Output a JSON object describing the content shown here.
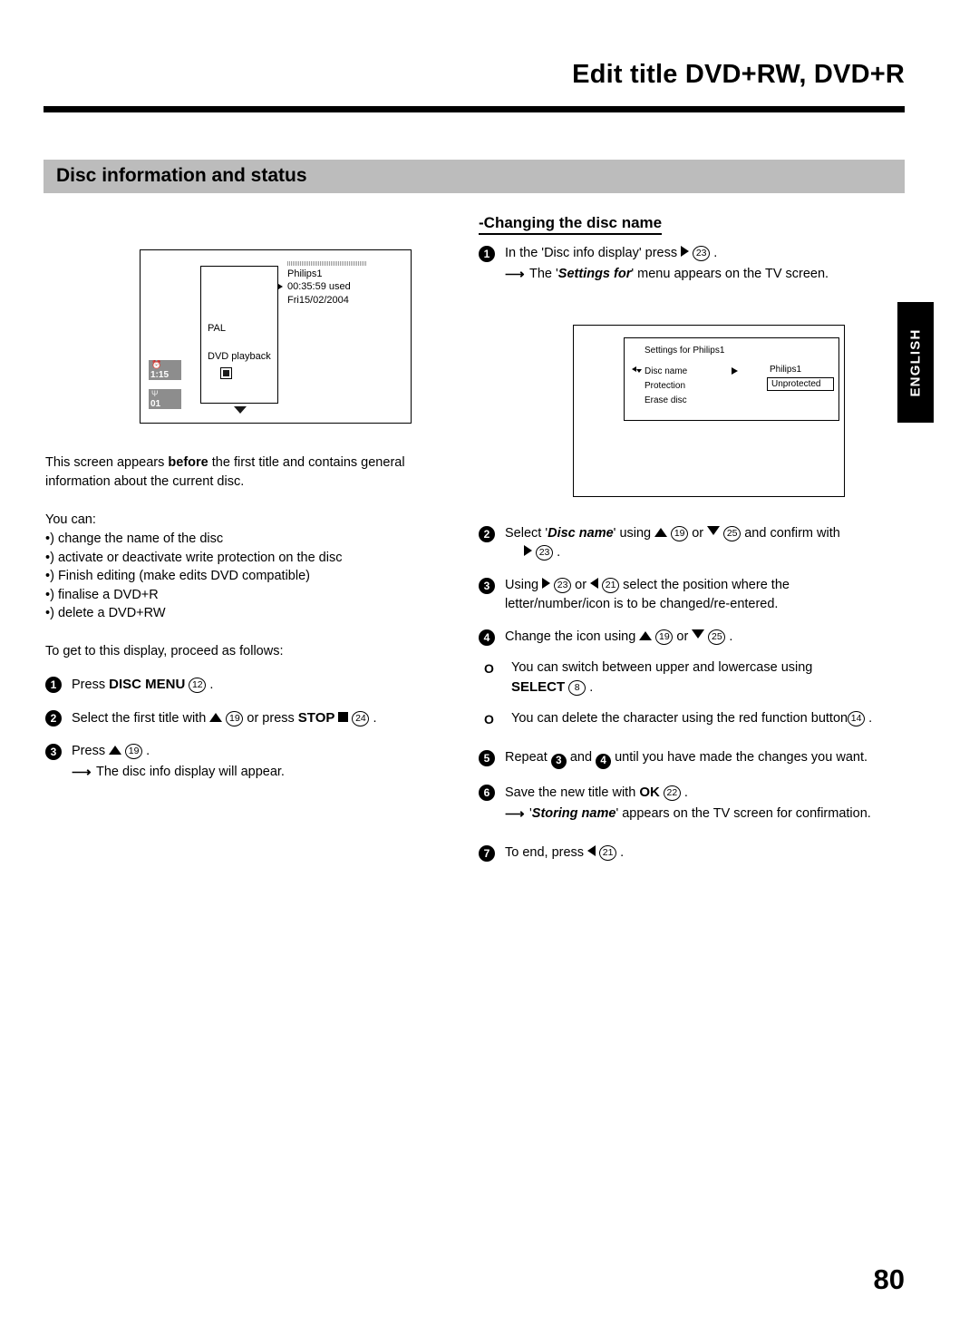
{
  "header": {
    "title": "Edit title DVD+RW, DVD+R"
  },
  "section": {
    "title": "Disc information and status"
  },
  "side_tab": {
    "language": "ENGLISH"
  },
  "disc_info_screen": {
    "disc_name": "Philips1",
    "time_used": "00:35:59 used",
    "date": "Fri15/02/2004",
    "video_standard": "PAL",
    "playback_label": "DVD playback",
    "timer_badge": "1:15",
    "channel_badge": "01"
  },
  "settings_screen": {
    "title": "Settings for Philips1",
    "items": [
      "Disc name",
      "Protection",
      "Erase disc"
    ],
    "value_disc_name": "Philips1",
    "value_protection": "Unprotected"
  },
  "left_column": {
    "intro_1": "This screen appears ",
    "intro_bold": "before",
    "intro_2": " the first title and contains general",
    "intro_line2": "information about the current disc.",
    "you_can_label": "You can:",
    "capabilities": [
      "change the name of the disc",
      "activate or deactivate write protection on the disc",
      "Finish editing (make edits DVD compatible)",
      "finalise a DVD+R",
      "delete a DVD+RW"
    ],
    "howto_label": "To get to this display, proceed as follows:",
    "steps": [
      {
        "num": "1",
        "pre": "Press",
        "key": "DISC MENU",
        "ref": "12",
        "post": "."
      },
      {
        "num": "2",
        "pre": "Select the first title with",
        "ref_up": "19",
        "mid": "or press",
        "key": "STOP",
        "ref_stop": "24",
        "post": "."
      },
      {
        "num": "3",
        "pre": "Press",
        "ref_up": "19",
        "post": ".",
        "result": "The disc info display will appear."
      }
    ]
  },
  "right_column": {
    "heading": "-Changing the disc name",
    "step1": {
      "num": "1",
      "text_pre": "In the 'Disc info display' press",
      "ref": "23",
      "text_post": ".",
      "result_pre": "The '",
      "result_em": "Settings for",
      "result_post": "' menu appears on the TV screen."
    },
    "step2": {
      "num": "2",
      "pre": "Select '",
      "em": "Disc name",
      "mid1": "' using",
      "ref_up": "19",
      "mid2": "or",
      "ref_down": "25",
      "mid3": "and confirm with",
      "ref_right": "23",
      "post": "."
    },
    "step3": {
      "num": "3",
      "pre": "Using",
      "ref_right": "23",
      "mid": "or",
      "ref_left": "21",
      "post": "select the position where the",
      "line2": "letter/number/icon is to be changed/re-entered."
    },
    "step4": {
      "num": "4",
      "pre": "Change the icon using",
      "ref_up": "19",
      "mid": "or",
      "ref_down": "25",
      "post": "."
    },
    "notes": [
      {
        "text": "You can switch between upper and lowercase using",
        "key": "SELECT",
        "ref": "8",
        "post": "."
      },
      {
        "text": "You can delete the character using the red function button",
        "ref": "14",
        "post": "."
      }
    ],
    "step5": {
      "num": "5",
      "pre": "Repeat",
      "n1": "3",
      "mid": "and",
      "n2": "4",
      "post": "until you have made the changes you want."
    },
    "step6": {
      "num": "6",
      "pre": "Save the new title with",
      "key": "OK",
      "ref": "22",
      "post": ".",
      "result_pre": "'",
      "result_em": "Storing name",
      "result_post": "' appears on the TV screen for confirmation."
    },
    "step7": {
      "num": "7",
      "pre": "To end, press",
      "ref": "21",
      "post": "."
    }
  },
  "page_number": "80"
}
